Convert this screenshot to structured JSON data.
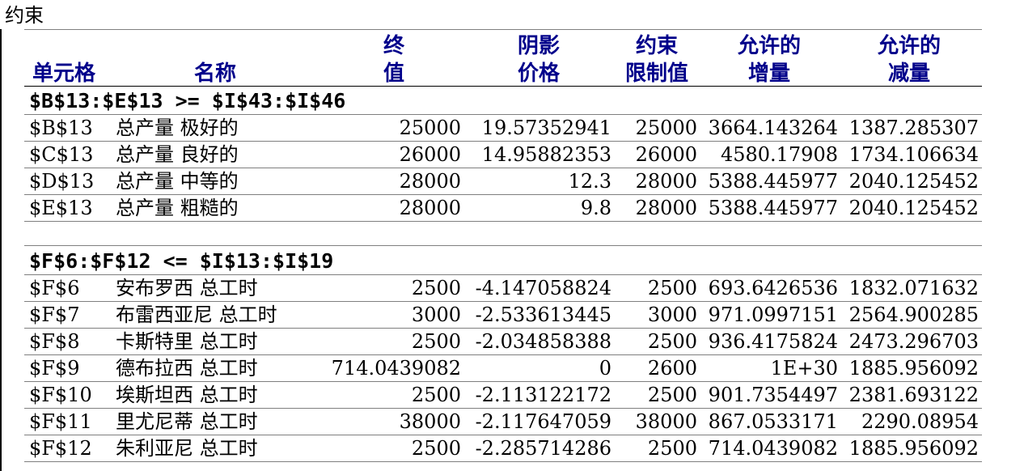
{
  "title": "约束",
  "headers": {
    "cell": "单元格",
    "name": "名称",
    "final_1": "终",
    "final_2": "值",
    "shadow_1": "阴影",
    "shadow_2": "价格",
    "constraint_1": "约束",
    "constraint_2": "限制值",
    "increase_1": "允许的",
    "increase_2": "增量",
    "decrease_1": "允许的",
    "decrease_2": "减量"
  },
  "groups": [
    {
      "label": "$B$13:$E$13 >= $I$43:$I$46",
      "rows": [
        {
          "cell": "$B$13",
          "name": "总产量 极好的",
          "final": "25000",
          "shadow": "19.57352941",
          "rhs": "25000",
          "inc": "3664.143264",
          "dec": "1387.285307"
        },
        {
          "cell": "$C$13",
          "name": "总产量 良好的",
          "final": "26000",
          "shadow": "14.95882353",
          "rhs": "26000",
          "inc": "4580.17908",
          "dec": "1734.106634"
        },
        {
          "cell": "$D$13",
          "name": "总产量 中等的",
          "final": "28000",
          "shadow": "12.3",
          "rhs": "28000",
          "inc": "5388.445977",
          "dec": "2040.125452"
        },
        {
          "cell": "$E$13",
          "name": "总产量 粗糙的",
          "final": "28000",
          "shadow": "9.8",
          "rhs": "28000",
          "inc": "5388.445977",
          "dec": "2040.125452"
        }
      ]
    },
    {
      "label": "$F$6:$F$12 <= $I$13:$I$19",
      "rows": [
        {
          "cell": "$F$6",
          "name": "安布罗西 总工时",
          "final": "2500",
          "shadow": "-4.147058824",
          "rhs": "2500",
          "inc": "693.6426536",
          "dec": "1832.071632"
        },
        {
          "cell": "$F$7",
          "name": "布雷西亚尼 总工时",
          "final": "3000",
          "shadow": "-2.533613445",
          "rhs": "3000",
          "inc": "971.0997151",
          "dec": "2564.900285"
        },
        {
          "cell": "$F$8",
          "name": "卡斯特里 总工时",
          "final": "2500",
          "shadow": "-2.034858388",
          "rhs": "2500",
          "inc": "936.4175824",
          "dec": "2473.296703"
        },
        {
          "cell": "$F$9",
          "name": "德布拉西 总工时",
          "final": "714.0439082",
          "shadow": "0",
          "rhs": "2600",
          "inc": "1E+30",
          "dec": "1885.956092"
        },
        {
          "cell": "$F$10",
          "name": "埃斯坦西 总工时",
          "final": "2500",
          "shadow": "-2.113122172",
          "rhs": "2500",
          "inc": "901.7354497",
          "dec": "2381.693122"
        },
        {
          "cell": "$F$11",
          "name": "里尤尼蒂 总工时",
          "final": "38000",
          "shadow": "-2.117647059",
          "rhs": "38000",
          "inc": "867.0533171",
          "dec": "2290.08954"
        },
        {
          "cell": "$F$12",
          "name": "朱利亚尼 总工时",
          "final": "2500",
          "shadow": "-2.285714286",
          "rhs": "2500",
          "inc": "714.0439082",
          "dec": "1885.956092"
        }
      ]
    }
  ]
}
